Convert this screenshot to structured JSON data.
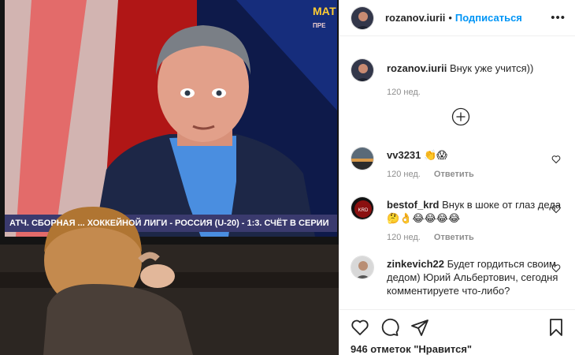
{
  "header": {
    "username": "rozanov.iurii",
    "separator": "•",
    "follow_label": "Подписаться",
    "more_label": "•••"
  },
  "photo": {
    "channel_logo": "МАТ",
    "channel_sub": "ПРЕ",
    "ticker": "АТЧ. СБОРНАЯ ... ХОККЕЙНОЙ ЛИГИ - РОССИЯ (U-20) - 1:3. СЧЁТ В СЕРИИ"
  },
  "caption": {
    "username": "rozanov.iurii",
    "text": "Внук уже учится))",
    "time": "120 нед."
  },
  "comments": [
    {
      "username": "vv3231",
      "text": "👏😱",
      "time": "120 нед.",
      "reply": "Ответить"
    },
    {
      "username": "bestof_krd",
      "text": "Внук в шоке от глаз деда 🤔👌😂😂😂😂",
      "time": "120 нед.",
      "reply": "Ответить"
    },
    {
      "username": "zinkevich22",
      "text": "Будет гордиться своим дедом) Юрий Альбертович, сегодня комментируете что-либо?",
      "time": "",
      "reply": ""
    }
  ],
  "footer": {
    "likes": "946 отметок \"Нравится\""
  },
  "colors": {
    "accent": "#0095f6",
    "muted": "#8e8e8e",
    "ticker_bg": "#3a3a6e"
  }
}
